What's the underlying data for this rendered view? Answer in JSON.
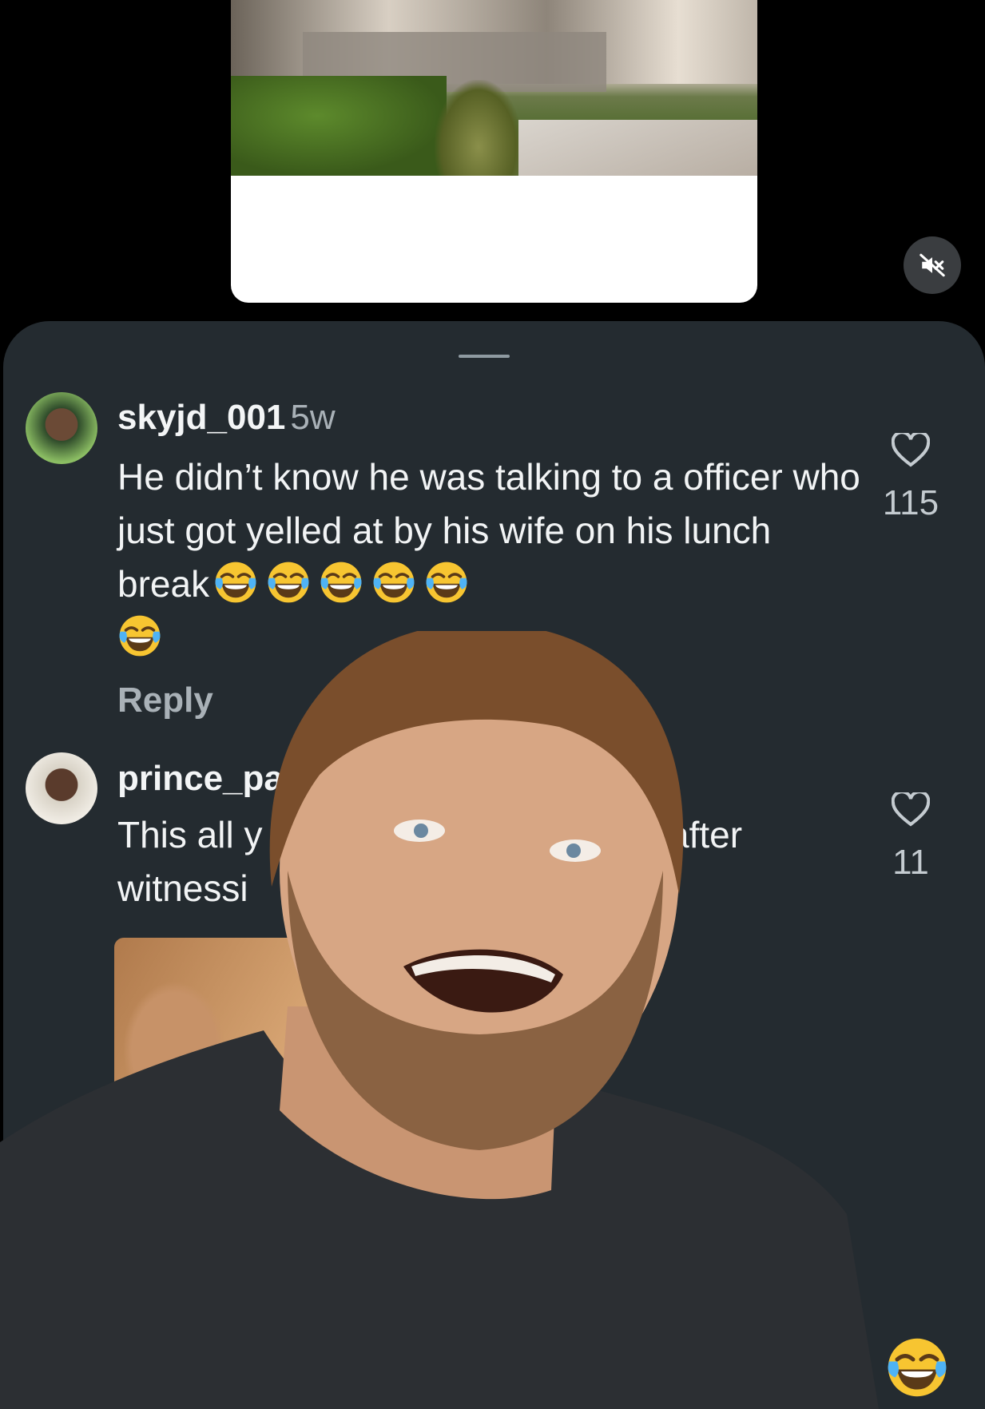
{
  "video_preview": {
    "media": "video-still"
  },
  "mute_button": {
    "icon": "speaker-muted-icon"
  },
  "comments": [
    {
      "username": "skyjd_001",
      "time": "5w",
      "text": "He didn’t know he was talking to a officer who just got yelled at by his wife on his lunch break",
      "emoji_count_inline": 5,
      "emoji_count_wrap": 1,
      "reply_label": "Reply",
      "likes": "115",
      "like_icon": "heart-outline-icon"
    },
    {
      "username": "prince_pa",
      "time": "",
      "text_line1_start": "This all y",
      "text_line1_end": "after",
      "text_line2": "witnessi",
      "likes": "11",
      "like_icon": "heart-outline-icon",
      "attachment": "image"
    }
  ],
  "overlay": {
    "type": "creator-cutout-video"
  },
  "corner_emoji": "face-with-tears-of-joy-icon",
  "colors": {
    "sheet_bg": "#242b30",
    "primary_text": "#f2f4f5",
    "secondary_text": "#a9b1b7",
    "accent_emoji": "#f7c531"
  }
}
